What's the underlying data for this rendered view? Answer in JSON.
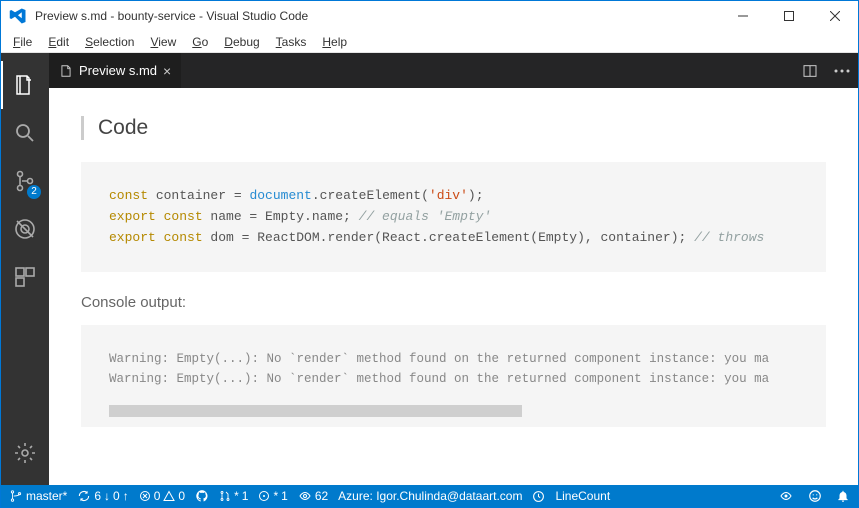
{
  "titlebar": {
    "title": "Preview s.md - bounty-service - Visual Studio Code"
  },
  "menu": {
    "file": "File",
    "edit": "Edit",
    "selection": "Selection",
    "view": "View",
    "go": "Go",
    "debug": "Debug",
    "tasks": "Tasks",
    "help": "Help"
  },
  "activity": {
    "scm_badge": "2"
  },
  "tab": {
    "label": "Preview s.md"
  },
  "preview": {
    "code_heading": "Code",
    "code_line1_kw1": "const",
    "code_line1_ident": " container = ",
    "code_line1_obj": "document",
    "code_line1_rest": ".createElement(",
    "code_line1_str": "'div'",
    "code_line1_end": ");",
    "code_line2_kw1": "export",
    "code_line2_kw2": " const",
    "code_line2_rest": " name = Empty.name; ",
    "code_line2_comment": "// equals 'Empty'",
    "code_line3_kw1": "export",
    "code_line3_kw2": " const",
    "code_line3_rest": " dom = ReactDOM.render(React.createElement(Empty), container); ",
    "code_line3_comment": "// throws",
    "console_label": "Console output:",
    "console_line1": "Warning: Empty(...): No `render` method found on the returned component instance: you ma",
    "console_line2": "Warning: Empty(...): No `render` method found on the returned component instance: you ma"
  },
  "statusbar": {
    "branch": "master*",
    "sync_down": "6",
    "sync_up": "0",
    "errors": "0",
    "warnings": "0",
    "pr": "1",
    "issue": "1",
    "views": "62",
    "azure": "Azure: Igor.Chulinda@dataart.com",
    "linecount": "LineCount"
  }
}
